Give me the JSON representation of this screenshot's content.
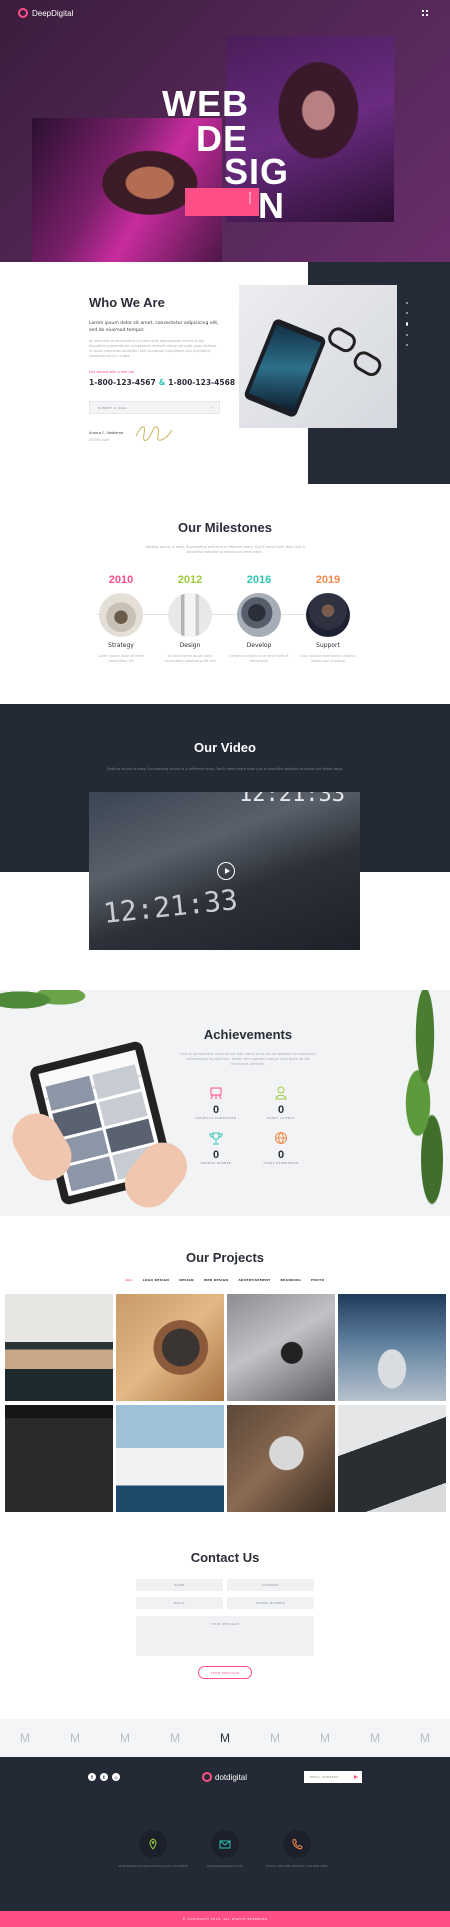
{
  "header": {
    "logo_text": "DeepDigital"
  },
  "hero": {
    "words": [
      "WEB",
      "DE",
      "SIG",
      "N"
    ],
    "side_label": "DESIGN"
  },
  "who": {
    "title": "Who We Are",
    "lead": "Lorem ipsum dolor sit amet, consectetur adipisicing elit, sed do eiusmod tempor.",
    "body": "At vero eos et accusamus et iusto odio dignissimos ducimus qui blanditiis praesentium voluptatum deleniti atque corrupti quos dolores et quas molestias excepturi sint occaecati cupiditate non provident, similique sunt in culpa.",
    "contact_label": "Get started with a free call",
    "phone1": "1-800-123-4567",
    "amp": "&",
    "phone2": "1-800-123-4568",
    "call_button": "SUBMIT A CALL",
    "person_name": "Aurora C. Nadiame",
    "person_role": "CEO/Founder"
  },
  "milestones": {
    "title": "Our Milestones",
    "intro": "Getting online is easy. Succeeding online is a different story. You'll need more than just a beautiful website to stand out these days.",
    "items": [
      {
        "year": "2010",
        "color": "#ff4f86",
        "title": "Strategy",
        "desc": "Lorem ipsum dolor sit amet consectetur elit"
      },
      {
        "year": "2012",
        "color": "#9ccc3c",
        "title": "Design",
        "desc": "Sit amet lorem ipsum dolor consectetur adipisicing elit sed"
      },
      {
        "year": "2016",
        "color": "#2ec4b6",
        "title": "Develop",
        "desc": "Integer tincidunt ut sit amet ante et elementum"
      },
      {
        "year": "2019",
        "color": "#f08a4b",
        "title": "Support",
        "desc": "Quis nostrud exercitation ullamco laboris nisi ut aliquip"
      }
    ]
  },
  "video": {
    "title": "Our Video",
    "intro": "Getting online is easy. Succeeding online is a different story. You'll need more than just a beautiful website to stand out these days.",
    "clock1": "12:21:33",
    "clock2": "12:21:33"
  },
  "achievements": {
    "title": "Achievements",
    "intro": "Sed ut perspiciatis unde omnis iste natus error sit voluptatem accusantium doloremque laudantium, totam rem aperiam eaque ipsa quae ab illo inventore veritatis.",
    "items": [
      {
        "value": "0",
        "label": "PROJECTS COMPLETED",
        "icon": "easel-icon",
        "color": "#ff4f86"
      },
      {
        "value": "0",
        "label": "HAPPY CLIENTS",
        "icon": "person-icon",
        "color": "#9ccc3c"
      },
      {
        "value": "0",
        "label": "AWARDS WINNED",
        "icon": "trophy-icon",
        "color": "#2ec4b6"
      },
      {
        "value": "0",
        "label": "YEARS EXPERIENCE",
        "icon": "globe-icon",
        "color": "#f08a4b"
      }
    ]
  },
  "projects": {
    "title": "Our Projects",
    "filters": [
      "ALL",
      "LOGO DESIGN",
      "DESIGN",
      "WEB DESIGN",
      "ADVERTISEMENT",
      "BRANDING",
      "PHOTO"
    ]
  },
  "contact": {
    "title": "Contact Us",
    "name": "NAME",
    "company": "COMPANY",
    "email": "EMAIL",
    "phone": "PHONE NUMBER",
    "message": "YOUR MESSAGE",
    "send": "SEND MESSAGE"
  },
  "brands": [
    "M",
    "M",
    "M",
    "M",
    "M",
    "M",
    "M",
    "M",
    "M"
  ],
  "footer": {
    "logo_text": "dotdigital",
    "newsletter_placeholder": "EMAIL ADDRESS",
    "address": "2048 Dashwood Avenue Sunnyvale, CA 95076",
    "email": "example@example.com",
    "phone": "Phone: 123-456-7890 Fax: 123-456-7890",
    "copyright": "© COPYRIGHT 2019. ALL RIGHTS RESERVED"
  },
  "colors": {
    "accent": "#ff4f86",
    "dark": "#232935"
  }
}
